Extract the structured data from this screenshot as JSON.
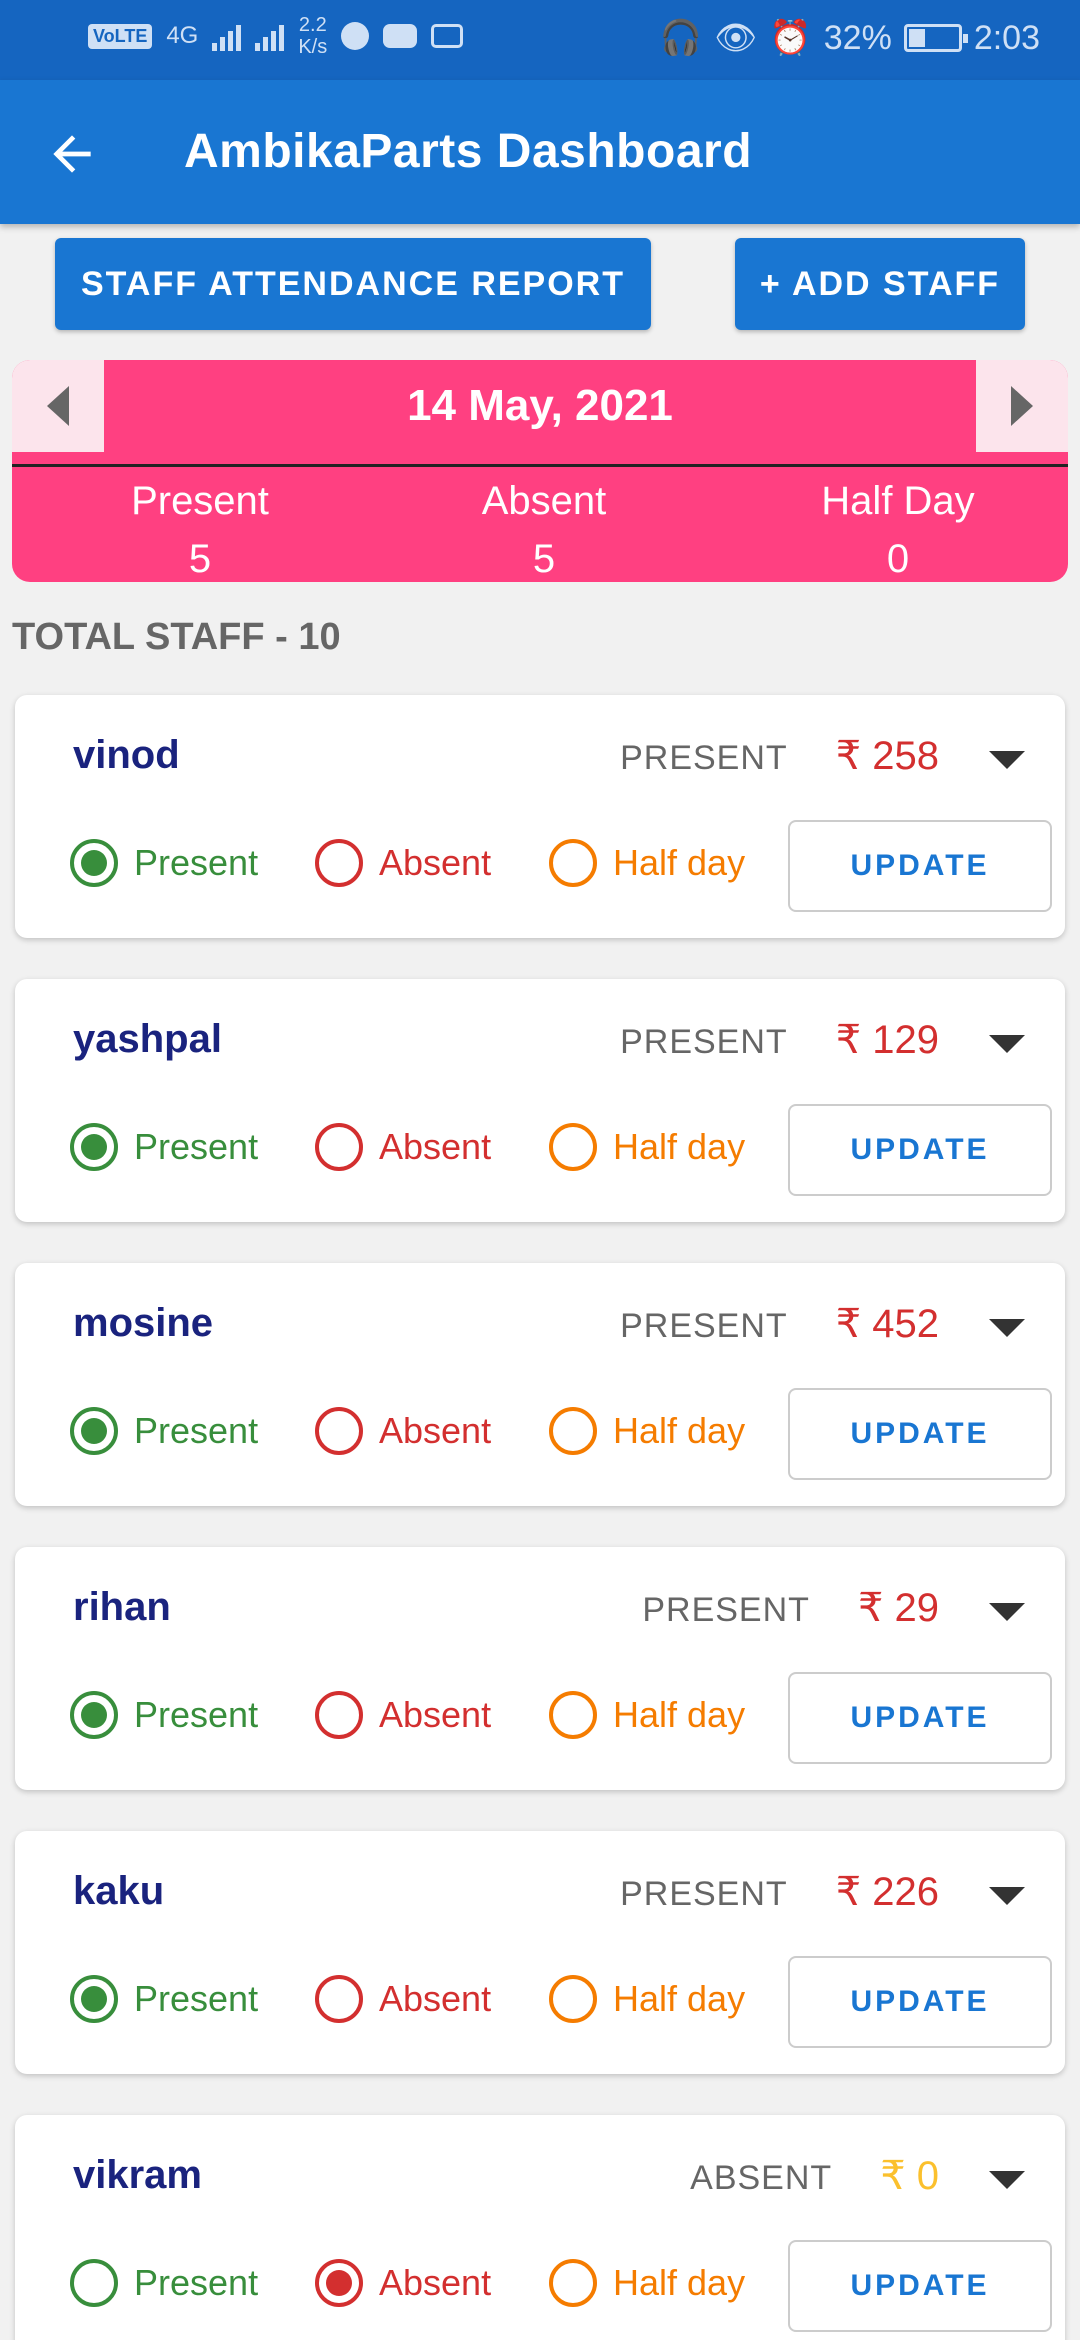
{
  "statusbar": {
    "network_badge": "VoLTE",
    "net_type": "4G",
    "speed_value": "2.2",
    "speed_unit": "K/s",
    "battery": "32%",
    "time": "2:03"
  },
  "appbar": {
    "title": "AmbikaParts Dashboard"
  },
  "actions": {
    "report_label": "STAFF ATTENDANCE REPORT",
    "add_label": "+ ADD STAFF"
  },
  "date_panel": {
    "date": "14 May, 2021",
    "present_label": "Present",
    "present_count": "5",
    "absent_label": "Absent",
    "absent_count": "5",
    "halfday_label": "Half Day",
    "halfday_count": "0"
  },
  "total_label": "TOTAL STAFF - 10",
  "option_labels": {
    "present": "Present",
    "absent": "Absent",
    "halfday": "Half day"
  },
  "update_label": "UPDATE",
  "staff": [
    {
      "name": "vinod",
      "status": "PRESENT",
      "amount": "₹ 258",
      "selected": "present"
    },
    {
      "name": "yashpal",
      "status": "PRESENT",
      "amount": "₹ 129",
      "selected": "present"
    },
    {
      "name": "mosine",
      "status": "PRESENT",
      "amount": "₹ 452",
      "selected": "present"
    },
    {
      "name": "rihan",
      "status": "PRESENT",
      "amount": "₹ 29",
      "selected": "present"
    },
    {
      "name": "kaku",
      "status": "PRESENT",
      "amount": "₹ 226",
      "selected": "present"
    },
    {
      "name": "vikram",
      "status": "ABSENT",
      "amount": "₹ 0",
      "selected": "absent"
    }
  ],
  "colors": {
    "status_bar": "#1565c0",
    "app_bar": "#1976d2",
    "date_panel": "#ff4081",
    "present": "#388e3c",
    "absent": "#d32f2f",
    "half_day": "#f57c00",
    "amount_zero": "#fbc02d"
  }
}
